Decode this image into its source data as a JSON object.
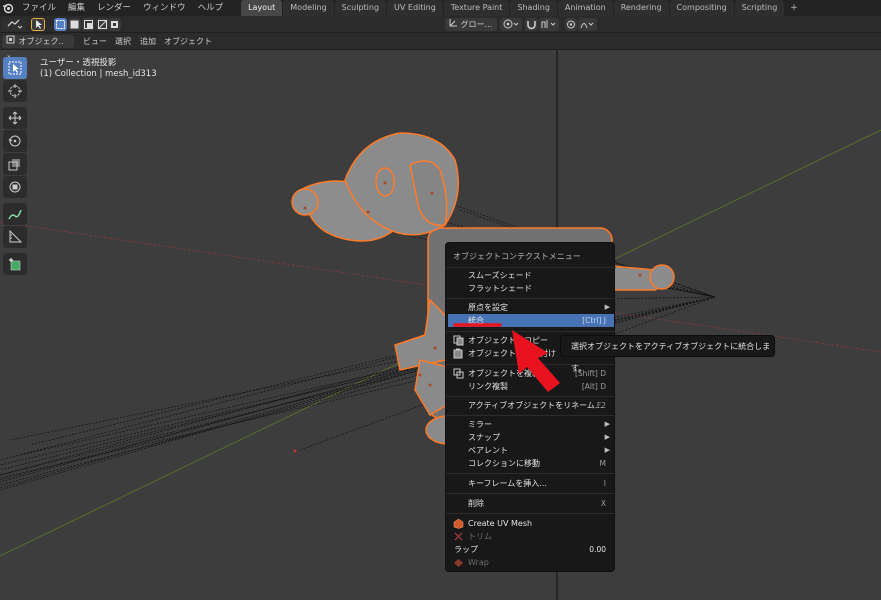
{
  "topbar": {
    "menus": [
      "ファイル",
      "編集",
      "レンダー",
      "ウィンドウ",
      "ヘルプ"
    ],
    "tabs": [
      "Layout",
      "Modeling",
      "Sculpting",
      "UV Editing",
      "Texture Paint",
      "Shading",
      "Animation",
      "Rendering",
      "Compositing",
      "Scripting"
    ],
    "active_tab": "Layout",
    "add_tab": "+"
  },
  "header": {
    "mode_label": "オブジェク..",
    "view_menu": "ビュー",
    "select_menu": "選択",
    "add_menu": "追加",
    "object_menu": "オブジェクト",
    "transform_orientation": "グロー..."
  },
  "viewport": {
    "view_name": "ユーザー・透視投影",
    "collection_info": "(1) Collection | mesh_id313"
  },
  "context_menu": {
    "title": "オブジェクトコンテクストメニュー",
    "items": [
      {
        "label": "スムーズシェード",
        "shortcut": ""
      },
      {
        "label": "フラットシェード",
        "shortcut": ""
      },
      {
        "label": "原点を設定",
        "shortcut": ""
      },
      {
        "label": "統合",
        "shortcut": "[Ctrl] J"
      },
      {
        "label": "オブジェクトをコピー",
        "shortcut": ""
      },
      {
        "label": "オブジェクトを貼り付け",
        "shortcut": ""
      },
      {
        "label": "オブジェクトを複製",
        "shortcut": "[Shift] D"
      },
      {
        "label": "リンク複製",
        "shortcut": "[Alt] D"
      },
      {
        "label": "アクティブオブジェクトをリネーム...",
        "shortcut": "F2"
      },
      {
        "label": "ミラー",
        "shortcut": ""
      },
      {
        "label": "スナップ",
        "shortcut": ""
      },
      {
        "label": "ペアレント",
        "shortcut": ""
      },
      {
        "label": "コレクションに移動",
        "shortcut": "M"
      },
      {
        "label": "キーフレームを挿入...",
        "shortcut": "I"
      },
      {
        "label": "削除",
        "shortcut": "X"
      },
      {
        "label": "Create UV Mesh",
        "shortcut": ""
      },
      {
        "label": "トリム",
        "shortcut": ""
      },
      {
        "label": "ラップ",
        "shortcut": "0.00"
      },
      {
        "label": "Wrap",
        "shortcut": ""
      }
    ]
  },
  "tooltip": {
    "text": "選択オブジェクトをアクティブオブジェクトに統合します。"
  },
  "colors": {
    "selection_outline": "#ff7a29",
    "highlight": "#4772b3",
    "annotation_red": "#e8131e"
  }
}
